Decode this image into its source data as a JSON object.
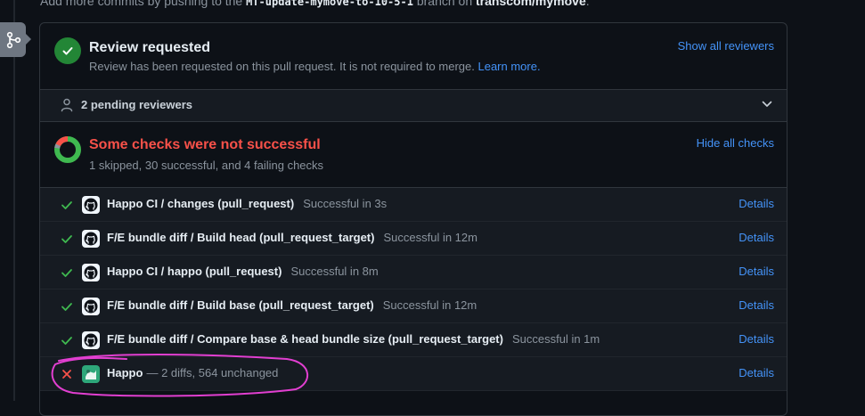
{
  "top_note": {
    "prefix": "Add more commits by pushing to the ",
    "branch": "MT-update-mymove-to-10-5-1",
    "middle": " branch on ",
    "repo": "transcom/mymove",
    "suffix": "."
  },
  "review": {
    "title": "Review requested",
    "description": "Review has been requested on this pull request. It is not required to merge.",
    "learn_more": "Learn more.",
    "show_all": "Show all reviewers"
  },
  "pending": {
    "label": "2 pending reviewers"
  },
  "checks": {
    "title": "Some checks were not successful",
    "summary": "1 skipped, 30 successful, and 4 failing checks",
    "hide_all": "Hide all checks",
    "items": [
      {
        "name": "Happo CI / changes (pull_request)",
        "status": "Successful in 3s",
        "details": "Details",
        "result": "success"
      },
      {
        "name": "F/E bundle diff / Build head (pull_request_target)",
        "status": "Successful in 12m",
        "details": "Details",
        "result": "success"
      },
      {
        "name": "Happo CI / happo (pull_request)",
        "status": "Successful in 8m",
        "details": "Details",
        "result": "success"
      },
      {
        "name": "F/E bundle diff / Build base (pull_request_target)",
        "status": "Successful in 12m",
        "details": "Details",
        "result": "success"
      },
      {
        "name": "F/E bundle diff / Compare base & head bundle size (pull_request_target)",
        "status": "Successful in 1m",
        "details": "Details",
        "result": "success"
      },
      {
        "name": "Happo",
        "status": "— 2 diffs, 564 unchanged",
        "details": "Details",
        "result": "failure"
      }
    ]
  },
  "colors": {
    "success": "#3fb950",
    "failure": "#f85149",
    "link": "#4493f8",
    "annotation": "#e23fd1"
  }
}
